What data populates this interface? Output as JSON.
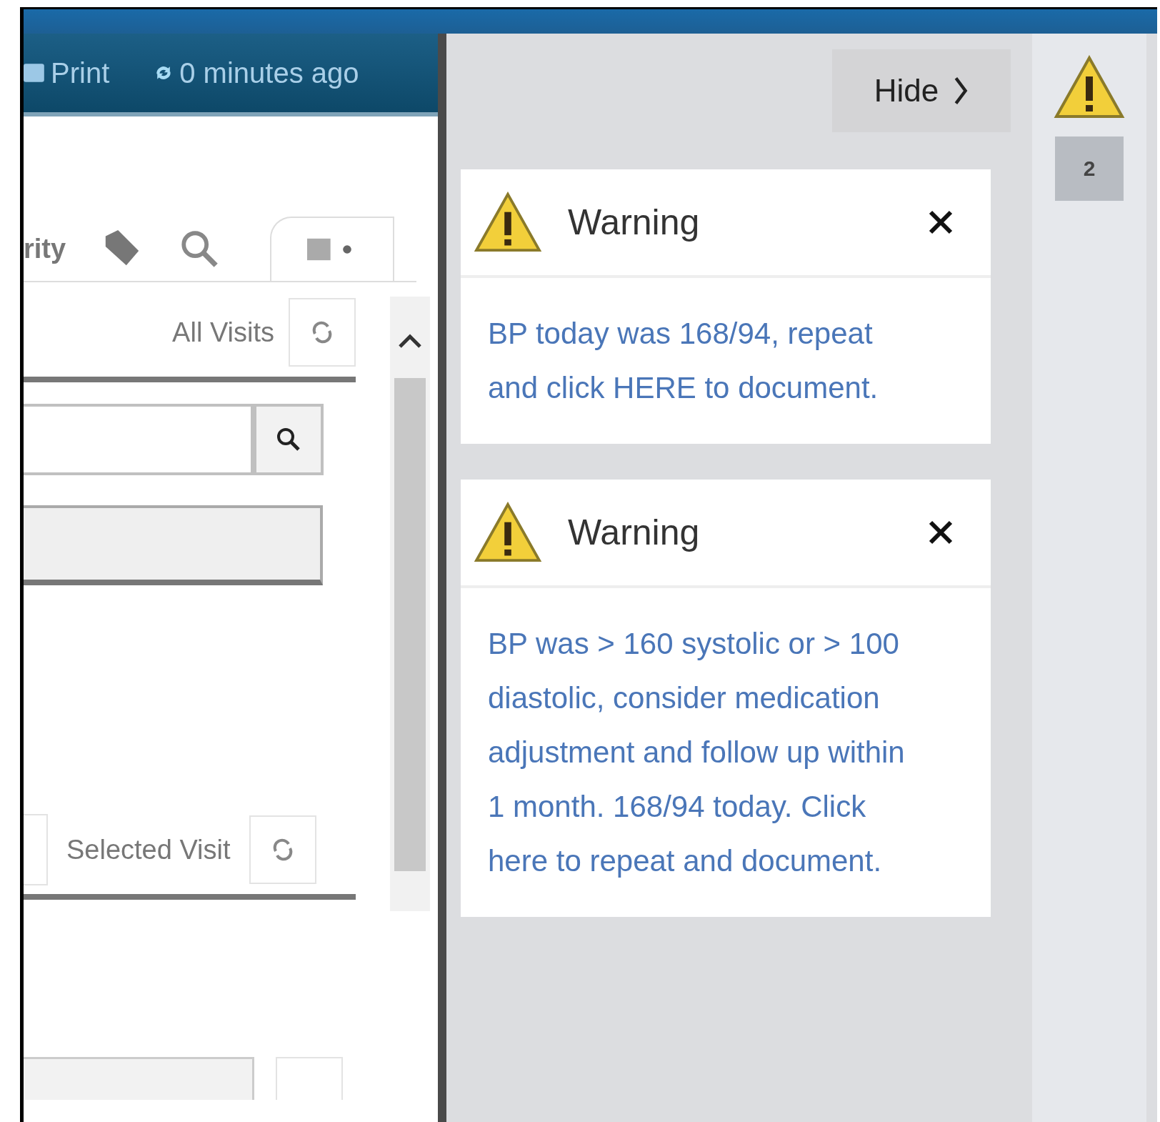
{
  "toolbar": {
    "print_label": "Print",
    "refresh_label": "0 minutes ago"
  },
  "left_panel": {
    "tab_label": "rity",
    "all_visits_label": "All Visits",
    "selected_visit_label": "Selected Visit"
  },
  "alerts_panel": {
    "hide_label": "Hide",
    "badge_count": "2",
    "alerts": [
      {
        "kind": "warning",
        "title": "Warning",
        "message": "BP today was 168/94, repeat and click HERE to document."
      },
      {
        "kind": "warning",
        "title": "Warning",
        "message": "BP was > 160 systolic or > 100 diastolic, consider medication adjustment and follow up within 1 month. 168/94 today. Click here to repeat and document."
      }
    ]
  }
}
